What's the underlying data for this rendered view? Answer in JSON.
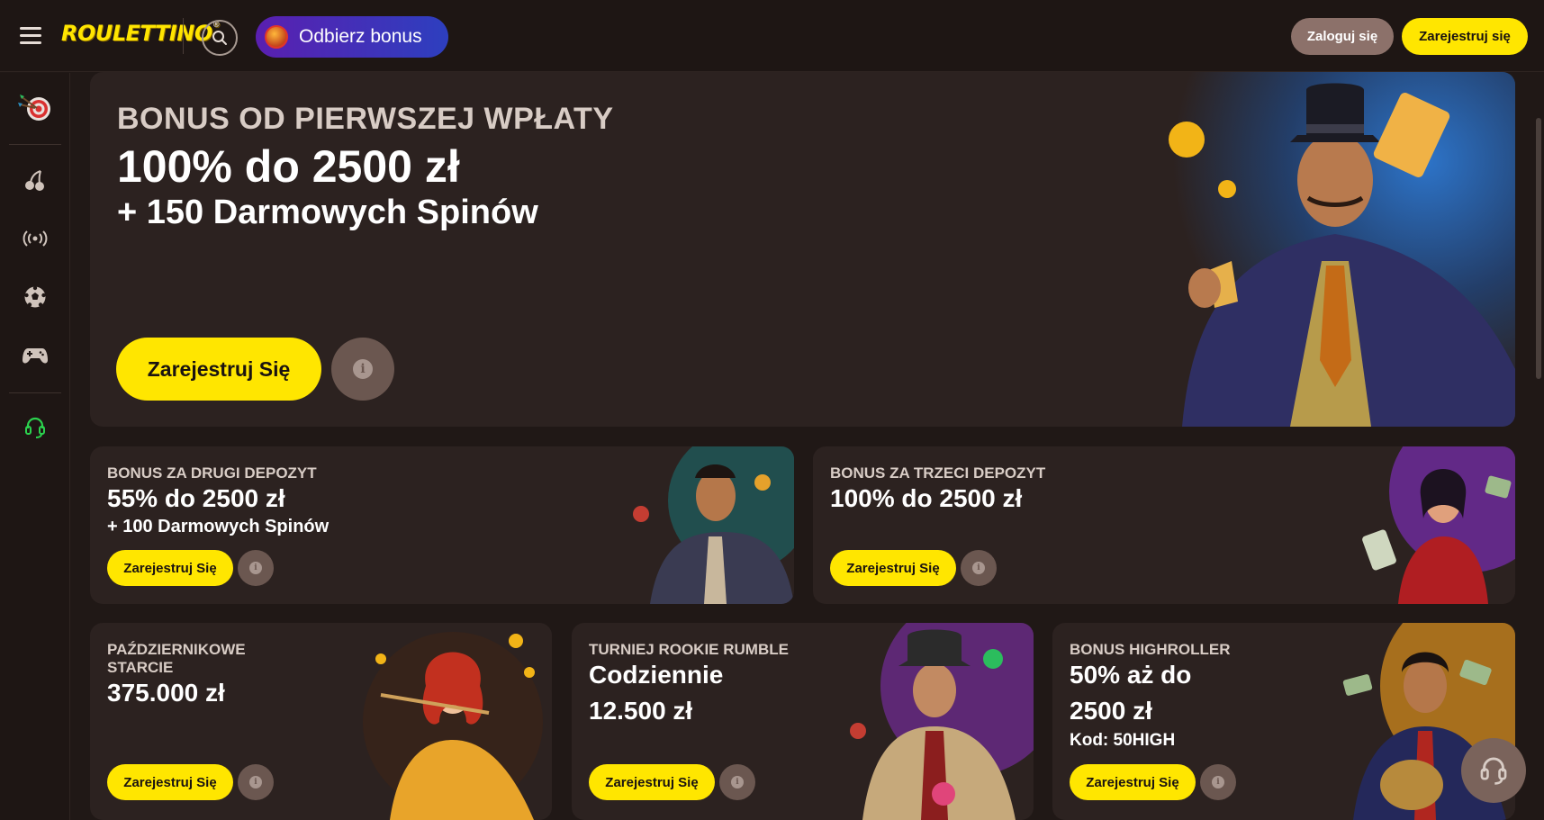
{
  "header": {
    "logo_text": "ROULETTINO",
    "bonus_label": "Odbierz bonus",
    "login_label": "Zaloguj się",
    "register_label": "Zarejestruj się"
  },
  "sidebar": {
    "items": [
      {
        "icon": "darts-target-icon"
      },
      {
        "icon": "cherries-icon"
      },
      {
        "icon": "live-broadcast-icon"
      },
      {
        "icon": "soccer-ball-icon"
      },
      {
        "icon": "gamepad-icon"
      },
      {
        "icon": "headset-support-icon"
      }
    ]
  },
  "hero": {
    "kicker": "BONUS OD PIERWSZEJ WPŁATY",
    "headline": "100% do 2500 zł",
    "sub": "+ 150 Darmowych Spinów",
    "cta": "Zarejestruj Się"
  },
  "cards": [
    {
      "kicker": "BONUS ZA DRUGI DEPOZYT",
      "headline": "55% do 2500 zł",
      "sub": "+ 100 Darmowych Spinów",
      "cta": "Zarejestruj Się"
    },
    {
      "kicker": "BONUS ZA TRZECI DEPOZYT",
      "headline": "100% do 2500 zł",
      "cta": "Zarejestruj Się"
    },
    {
      "kicker_line1": "PAŹDZIERNIKOWE",
      "kicker_line2": "STARCIE",
      "headline": "375.000 zł",
      "cta": "Zarejestruj Się"
    },
    {
      "kicker": "TURNIEJ ROOKIE RUMBLE",
      "headline": "Codziennie",
      "headline2": "12.500 zł",
      "cta": "Zarejestruj Się"
    },
    {
      "kicker": "BONUS HIGHROLLER",
      "headline": "50% aż do",
      "headline2": "2500 zł",
      "sub": "Kod: 50HIGH",
      "cta": "Zarejestruj Się"
    }
  ],
  "colors": {
    "accent_yellow": "#ffe600",
    "bg": "#201816",
    "card_bg": "#2c2220",
    "info_btn": "#6b5750",
    "bonus_pill_from": "#5a1fb0",
    "bonus_pill_to": "#2d3fbf"
  }
}
